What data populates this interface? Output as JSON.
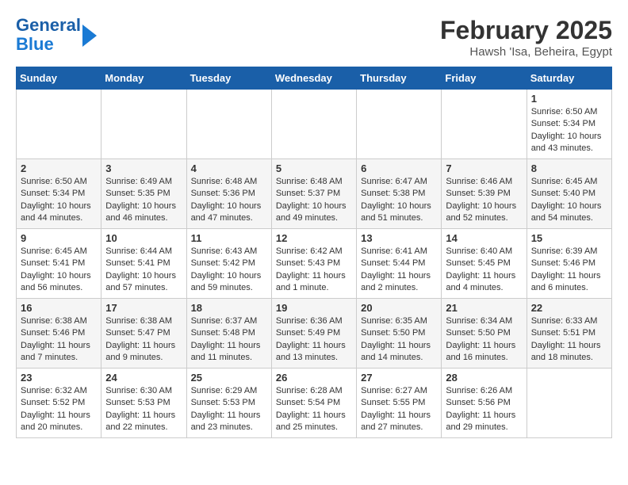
{
  "logo": {
    "line1": "General",
    "line2": "Blue"
  },
  "title": "February 2025",
  "location": "Hawsh 'Isa, Beheira, Egypt",
  "weekdays": [
    "Sunday",
    "Monday",
    "Tuesday",
    "Wednesday",
    "Thursday",
    "Friday",
    "Saturday"
  ],
  "weeks": [
    [
      {
        "day": "",
        "content": ""
      },
      {
        "day": "",
        "content": ""
      },
      {
        "day": "",
        "content": ""
      },
      {
        "day": "",
        "content": ""
      },
      {
        "day": "",
        "content": ""
      },
      {
        "day": "",
        "content": ""
      },
      {
        "day": "1",
        "content": "Sunrise: 6:50 AM\nSunset: 5:34 PM\nDaylight: 10 hours and 43 minutes."
      }
    ],
    [
      {
        "day": "2",
        "content": "Sunrise: 6:50 AM\nSunset: 5:34 PM\nDaylight: 10 hours and 44 minutes."
      },
      {
        "day": "3",
        "content": "Sunrise: 6:49 AM\nSunset: 5:35 PM\nDaylight: 10 hours and 46 minutes."
      },
      {
        "day": "4",
        "content": "Sunrise: 6:48 AM\nSunset: 5:36 PM\nDaylight: 10 hours and 47 minutes."
      },
      {
        "day": "5",
        "content": "Sunrise: 6:48 AM\nSunset: 5:37 PM\nDaylight: 10 hours and 49 minutes."
      },
      {
        "day": "6",
        "content": "Sunrise: 6:47 AM\nSunset: 5:38 PM\nDaylight: 10 hours and 51 minutes."
      },
      {
        "day": "7",
        "content": "Sunrise: 6:46 AM\nSunset: 5:39 PM\nDaylight: 10 hours and 52 minutes."
      },
      {
        "day": "8",
        "content": "Sunrise: 6:45 AM\nSunset: 5:40 PM\nDaylight: 10 hours and 54 minutes."
      }
    ],
    [
      {
        "day": "9",
        "content": "Sunrise: 6:45 AM\nSunset: 5:41 PM\nDaylight: 10 hours and 56 minutes."
      },
      {
        "day": "10",
        "content": "Sunrise: 6:44 AM\nSunset: 5:41 PM\nDaylight: 10 hours and 57 minutes."
      },
      {
        "day": "11",
        "content": "Sunrise: 6:43 AM\nSunset: 5:42 PM\nDaylight: 10 hours and 59 minutes."
      },
      {
        "day": "12",
        "content": "Sunrise: 6:42 AM\nSunset: 5:43 PM\nDaylight: 11 hours and 1 minute."
      },
      {
        "day": "13",
        "content": "Sunrise: 6:41 AM\nSunset: 5:44 PM\nDaylight: 11 hours and 2 minutes."
      },
      {
        "day": "14",
        "content": "Sunrise: 6:40 AM\nSunset: 5:45 PM\nDaylight: 11 hours and 4 minutes."
      },
      {
        "day": "15",
        "content": "Sunrise: 6:39 AM\nSunset: 5:46 PM\nDaylight: 11 hours and 6 minutes."
      }
    ],
    [
      {
        "day": "16",
        "content": "Sunrise: 6:38 AM\nSunset: 5:46 PM\nDaylight: 11 hours and 7 minutes."
      },
      {
        "day": "17",
        "content": "Sunrise: 6:38 AM\nSunset: 5:47 PM\nDaylight: 11 hours and 9 minutes."
      },
      {
        "day": "18",
        "content": "Sunrise: 6:37 AM\nSunset: 5:48 PM\nDaylight: 11 hours and 11 minutes."
      },
      {
        "day": "19",
        "content": "Sunrise: 6:36 AM\nSunset: 5:49 PM\nDaylight: 11 hours and 13 minutes."
      },
      {
        "day": "20",
        "content": "Sunrise: 6:35 AM\nSunset: 5:50 PM\nDaylight: 11 hours and 14 minutes."
      },
      {
        "day": "21",
        "content": "Sunrise: 6:34 AM\nSunset: 5:50 PM\nDaylight: 11 hours and 16 minutes."
      },
      {
        "day": "22",
        "content": "Sunrise: 6:33 AM\nSunset: 5:51 PM\nDaylight: 11 hours and 18 minutes."
      }
    ],
    [
      {
        "day": "23",
        "content": "Sunrise: 6:32 AM\nSunset: 5:52 PM\nDaylight: 11 hours and 20 minutes."
      },
      {
        "day": "24",
        "content": "Sunrise: 6:30 AM\nSunset: 5:53 PM\nDaylight: 11 hours and 22 minutes."
      },
      {
        "day": "25",
        "content": "Sunrise: 6:29 AM\nSunset: 5:53 PM\nDaylight: 11 hours and 23 minutes."
      },
      {
        "day": "26",
        "content": "Sunrise: 6:28 AM\nSunset: 5:54 PM\nDaylight: 11 hours and 25 minutes."
      },
      {
        "day": "27",
        "content": "Sunrise: 6:27 AM\nSunset: 5:55 PM\nDaylight: 11 hours and 27 minutes."
      },
      {
        "day": "28",
        "content": "Sunrise: 6:26 AM\nSunset: 5:56 PM\nDaylight: 11 hours and 29 minutes."
      },
      {
        "day": "",
        "content": ""
      }
    ]
  ]
}
